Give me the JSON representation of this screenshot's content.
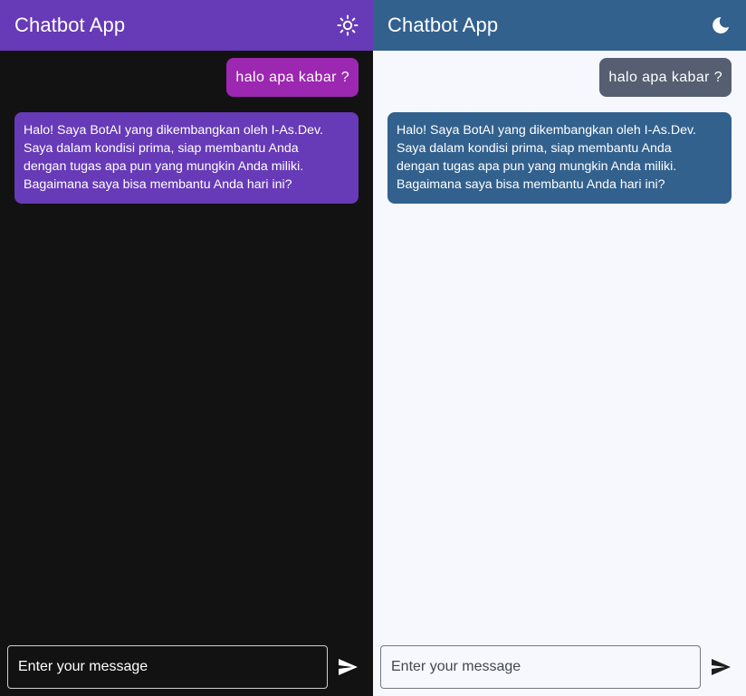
{
  "colors": {
    "dark_appbar": "#673ab7",
    "dark_background": "#121212",
    "dark_user_bubble": "#9c27b0",
    "dark_bot_bubble": "#673ab7",
    "light_appbar": "#33618e",
    "light_background": "#f6f8fe",
    "light_user_bubble": "#555f71",
    "light_bot_bubble": "#33618e"
  },
  "dark_screen": {
    "title": "Chatbot App",
    "theme_icon": "sun-icon",
    "messages": {
      "user": "halo apa kabar ?",
      "bot": "Halo! Saya BotAI yang dikembangkan oleh I-As.Dev.\nSaya dalam kondisi prima, siap membantu Anda\ndengan tugas apa pun yang mungkin Anda miliki.\nBagaimana saya bisa membantu Anda hari ini?"
    },
    "input": {
      "placeholder": "Enter your message",
      "value": ""
    },
    "send_icon": "send-icon"
  },
  "light_screen": {
    "title": "Chatbot App",
    "theme_icon": "moon-icon",
    "messages": {
      "user": "halo apa kabar ?",
      "bot": "Halo! Saya BotAI yang dikembangkan oleh I-As.Dev.\nSaya dalam kondisi prima, siap membantu Anda\ndengan tugas apa pun yang mungkin Anda miliki.\nBagaimana saya bisa membantu Anda hari ini?"
    },
    "input": {
      "placeholder": "Enter your message",
      "value": ""
    },
    "send_icon": "send-icon"
  }
}
